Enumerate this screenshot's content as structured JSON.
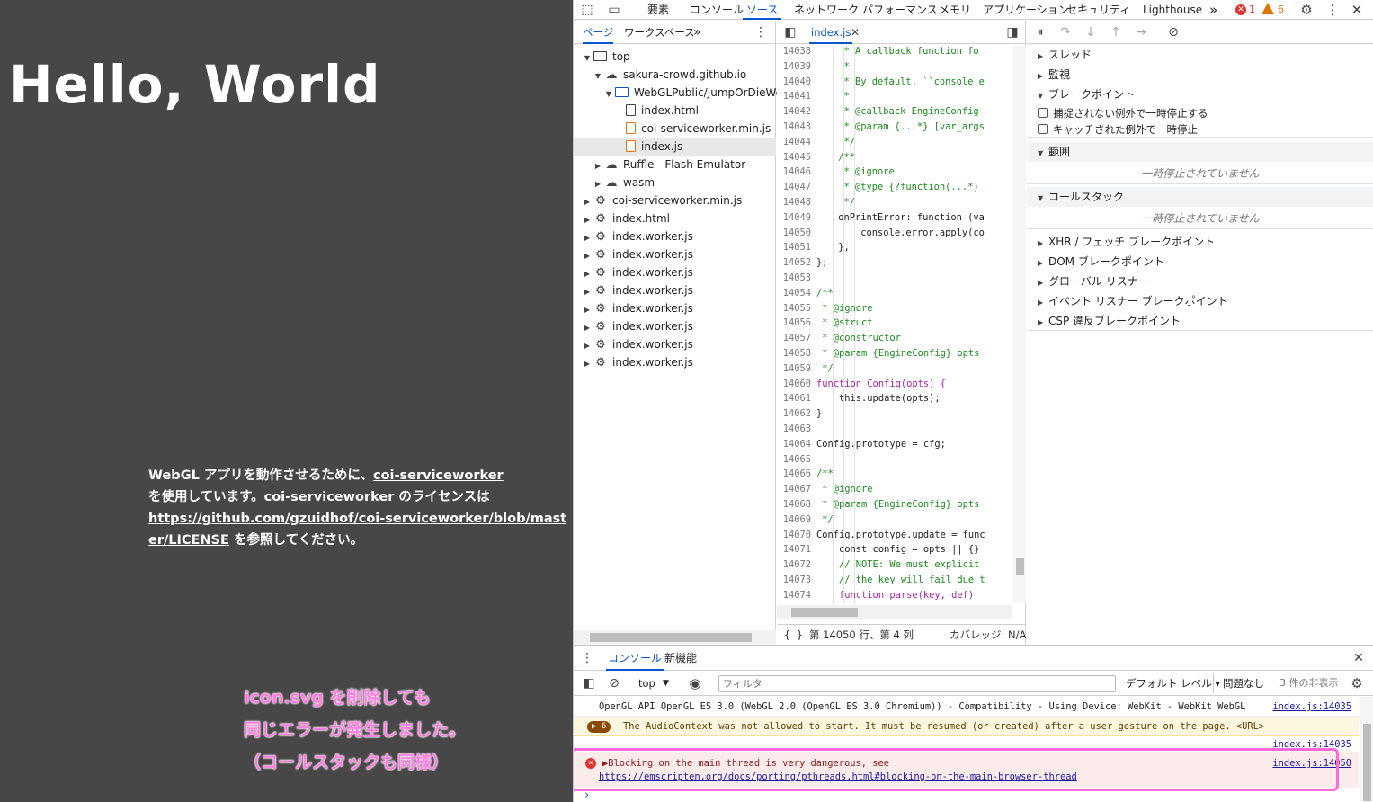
{
  "page": {
    "heading": "Hello, World",
    "license_pre": "WebGL アプリを動作させるために、",
    "license_link1": "coi-serviceworker",
    "license_mid": "を使用しています。coi-serviceworker のライセンスは",
    "license_link2": "https://github.com/gzuidhof/coi-serviceworker/blob/master/LICENSE",
    "license_post": " を参照してください。",
    "note": [
      "icon.svg を削除しても",
      "同じエラーが発生しました。",
      "（コールスタックも同様）"
    ]
  },
  "toolbar": {
    "tabs": [
      "要素",
      "コンソール",
      "ソース",
      "ネットワーク",
      "パフォーマンス",
      "メモリ",
      "アプリケーション",
      "セキュリティ",
      "Lighthouse"
    ],
    "active_tab": "ソース",
    "more": "»",
    "error_count": "1",
    "warning_count": "6"
  },
  "navigator": {
    "tabs": [
      "ページ",
      "ワークスペース"
    ],
    "more": "»",
    "tree": [
      {
        "label": "top",
        "type": "frame",
        "depth": 0,
        "expanded": true
      },
      {
        "label": "sakura-crowd.github.io",
        "type": "cloud",
        "depth": 1,
        "expanded": true
      },
      {
        "label": "WebGLPublic/JumpOrDieWebGL",
        "type": "folder",
        "depth": 2,
        "expanded": true
      },
      {
        "label": "index.html",
        "type": "file",
        "depth": 3
      },
      {
        "label": "coi-serviceworker.min.js",
        "type": "jsfile",
        "depth": 3
      },
      {
        "label": "index.js",
        "type": "jsfile",
        "depth": 3,
        "selected": true
      },
      {
        "label": "Ruffle - Flash Emulator",
        "type": "cloud",
        "depth": 1,
        "expanded": false
      },
      {
        "label": "wasm",
        "type": "cloud",
        "depth": 1,
        "expanded": false
      },
      {
        "label": "coi-serviceworker.min.js",
        "type": "gear",
        "depth": 0,
        "expanded": false
      },
      {
        "label": "index.html",
        "type": "gear",
        "depth": 0,
        "expanded": false
      },
      {
        "label": "index.worker.js",
        "type": "gear",
        "depth": 0,
        "expanded": false
      },
      {
        "label": "index.worker.js",
        "type": "gear",
        "depth": 0,
        "expanded": false
      },
      {
        "label": "index.worker.js",
        "type": "gear",
        "depth": 0,
        "expanded": false
      },
      {
        "label": "index.worker.js",
        "type": "gear",
        "depth": 0,
        "expanded": false
      },
      {
        "label": "index.worker.js",
        "type": "gear",
        "depth": 0,
        "expanded": false
      },
      {
        "label": "index.worker.js",
        "type": "gear",
        "depth": 0,
        "expanded": false
      },
      {
        "label": "index.worker.js",
        "type": "gear",
        "depth": 0,
        "expanded": false
      },
      {
        "label": "index.worker.js",
        "type": "gear",
        "depth": 0,
        "expanded": false
      }
    ]
  },
  "editor": {
    "tab": "index.js",
    "lines": [
      {
        "n": "14038",
        "t": "  * A callback function fo",
        "c": "cm",
        "i": 3
      },
      {
        "n": "14039",
        "t": "  *",
        "c": "cm",
        "i": 3
      },
      {
        "n": "14040",
        "t": "  * By default, ``console.e",
        "c": "cm",
        "i": 3
      },
      {
        "n": "14041",
        "t": "  *",
        "c": "cm",
        "i": 3
      },
      {
        "n": "14042",
        "t": "  * @callback EngineConfig",
        "c": "cm",
        "i": 3
      },
      {
        "n": "14043",
        "t": "  * @param {...*} [var_args",
        "c": "cm",
        "i": 3
      },
      {
        "n": "14044",
        "t": "  */",
        "c": "cm",
        "i": 3
      },
      {
        "n": "14045",
        "t": " /**",
        "c": "cm",
        "i": 3
      },
      {
        "n": "14046",
        "t": "  * @ignore",
        "c": "cm",
        "i": 3
      },
      {
        "n": "14047",
        "t": "  * @type {?function(...*)",
        "c": "cm",
        "i": 3
      },
      {
        "n": "14048",
        "t": "  */",
        "c": "cm",
        "i": 3
      },
      {
        "n": "14049",
        "t": " onPrintError: function (va",
        "c": "code",
        "i": 3
      },
      {
        "n": "14050",
        "t": "     console.error.apply(co",
        "c": "code",
        "i": 3
      },
      {
        "n": "14051",
        "t": " },",
        "c": "code",
        "i": 3
      },
      {
        "n": "14052",
        "t": "};",
        "c": "code",
        "i": 0
      },
      {
        "n": "14053",
        "t": "",
        "c": "code",
        "i": 0
      },
      {
        "n": "14054",
        "t": "/**",
        "c": "cm",
        "i": 0
      },
      {
        "n": "14055",
        "t": " * @ignore",
        "c": "cm",
        "i": 0
      },
      {
        "n": "14056",
        "t": " * @struct",
        "c": "cm",
        "i": 0
      },
      {
        "n": "14057",
        "t": " * @constructor",
        "c": "cm",
        "i": 0
      },
      {
        "n": "14058",
        "t": " * @param {EngineConfig} opts",
        "c": "cm",
        "i": 0
      },
      {
        "n": "14059",
        "t": " */",
        "c": "cm",
        "i": 0
      },
      {
        "n": "14060",
        "t": "function Config(opts) {",
        "c": "fn",
        "i": 0
      },
      {
        "n": "14061",
        "t": "    this.update(opts);",
        "c": "code",
        "i": 0
      },
      {
        "n": "14062",
        "t": "}",
        "c": "code",
        "i": 0
      },
      {
        "n": "14063",
        "t": "",
        "c": "code",
        "i": 0
      },
      {
        "n": "14064",
        "t": "Config.prototype = cfg;",
        "c": "code",
        "i": 0
      },
      {
        "n": "14065",
        "t": "",
        "c": "code",
        "i": 0
      },
      {
        "n": "14066",
        "t": "/**",
        "c": "cm",
        "i": 0
      },
      {
        "n": "14067",
        "t": " * @ignore",
        "c": "cm",
        "i": 0
      },
      {
        "n": "14068",
        "t": " * @param {EngineConfig} opts",
        "c": "cm",
        "i": 0
      },
      {
        "n": "14069",
        "t": " */",
        "c": "cm",
        "i": 0
      },
      {
        "n": "14070",
        "t": "Config.prototype.update = func",
        "c": "code",
        "i": 0
      },
      {
        "n": "14071",
        "t": "    const config = opts || {}",
        "c": "code",
        "i": 0
      },
      {
        "n": "14072",
        "t": "    // NOTE: We must explicit",
        "c": "cm",
        "i": 0
      },
      {
        "n": "14073",
        "t": "    // the key will fail due t",
        "c": "cm",
        "i": 0
      },
      {
        "n": "14074",
        "t": "    function parse(key, def)",
        "c": "fn",
        "i": 0
      }
    ],
    "status_position": "第 14050 行、第 4 列",
    "status_coverage": "カバレッジ: N/A"
  },
  "debugger": {
    "sections": [
      {
        "label": "スレッド",
        "expanded": false
      },
      {
        "label": "監視",
        "expanded": false
      },
      {
        "label": "ブレークポイント",
        "expanded": true
      }
    ],
    "checkbox1": "捕捉されない例外で一時停止する",
    "checkbox2": "キャッチされた例外で一時停止",
    "scope_label": "範囲",
    "not_paused": "一時停止されていません",
    "callstack_label": "コールスタック",
    "more_sections": [
      "XHR / フェッチ ブレークポイント",
      "DOM ブレークポイント",
      "グローバル リスナー",
      "イベント リスナー ブレークポイント",
      "CSP 違反ブレークポイント"
    ]
  },
  "drawer": {
    "tabs": [
      "コンソール",
      "新機能"
    ],
    "context": "top",
    "filter_placeholder": "フィルタ",
    "level": "デフォルト レベル ▾",
    "issues": "問題なし",
    "hidden": "3 件の非表示",
    "msg1": "OpenGL API OpenGL ES 3.0 (WebGL 2.0 (OpenGL ES 3.0 Chromium)) - Compatibility - Using Device: WebKit - WebKit WebGL",
    "msg1_src": "index.js:14035",
    "msg2_count": "6",
    "msg2": "The AudioContext was not allowed to start. It must be resumed (or created) after a user gesture on the page. <URL>",
    "msg3_src": "index.js:14035",
    "err_text": "▶Blocking on the main thread is very dangerous, see",
    "err_link": "https://emscripten.org/docs/porting/pthreads.html#blocking-on-the-main-browser-thread",
    "err_src": "index.js:14050",
    "prompt": "›"
  }
}
